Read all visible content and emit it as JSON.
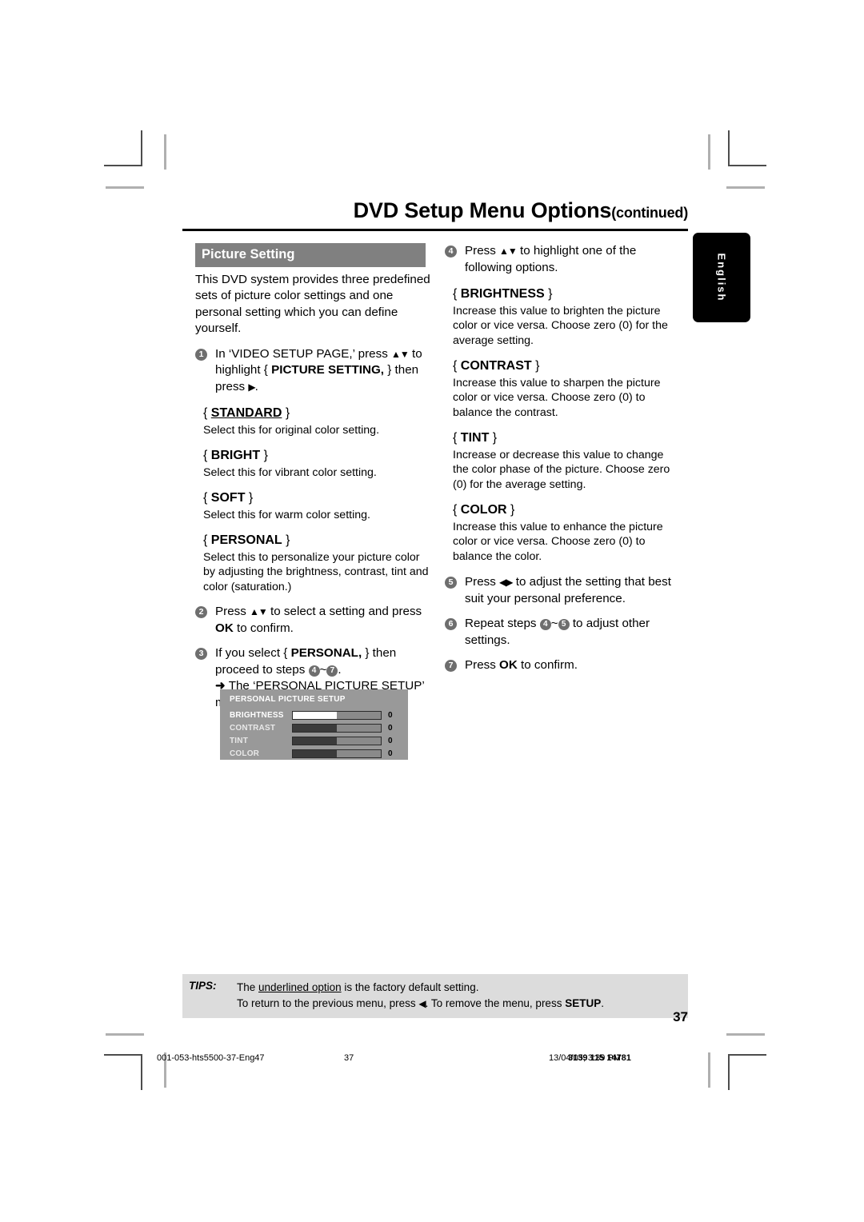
{
  "header": {
    "title": "DVD Setup Menu Options",
    "continued": "(continued)"
  },
  "language_tab": {
    "label": "English"
  },
  "left_column": {
    "section_title": "Picture Setting",
    "intro": "This DVD system provides three predefined sets of picture color settings and one personal setting which you can define yourself.",
    "step1": {
      "number": "1",
      "text_a": "In ‘VIDEO SETUP PAGE,’ press ",
      "arrows": "▲▼",
      "text_b": " to highlight { ",
      "bold_term": "PICTURE SETTING,",
      "text_c": " } then press ",
      "arrow_right": "▶",
      "text_d": "."
    },
    "options": [
      {
        "name": "STANDARD",
        "underlined": true,
        "desc": "Select this for original color setting."
      },
      {
        "name": "BRIGHT",
        "underlined": false,
        "desc": "Select this for vibrant color setting."
      },
      {
        "name": "SOFT",
        "underlined": false,
        "desc": "Select this for warm color setting."
      },
      {
        "name": "PERSONAL",
        "underlined": false,
        "desc": "Select this to personalize your picture color by adjusting the brightness, contrast, tint and color (saturation.)"
      }
    ],
    "step2": {
      "number": "2",
      "text_a": "Press ",
      "arrows": "▲▼",
      "text_b": " to select a setting and press ",
      "bold_term": "OK",
      "text_c": " to confirm."
    },
    "step3": {
      "number": "3",
      "text_a": "If you select { ",
      "bold_term": "PERSONAL,",
      "text_b": " } then proceed to steps ",
      "range_from": "4",
      "range_sep": "~",
      "range_to": "7",
      "text_c": ".",
      "arrow_note": "The ‘PERSONAL PICTURE SETUP’ menu appears.",
      "arrow_glyph": "➜"
    }
  },
  "osd_menu": {
    "title": "PERSONAL PICTURE SETUP",
    "rows": [
      {
        "label": "BRIGHTNESS",
        "value": "0",
        "fill_percent": 50,
        "selected": true
      },
      {
        "label": "CONTRAST",
        "value": "0",
        "fill_percent": 50,
        "selected": false
      },
      {
        "label": "TINT",
        "value": "0",
        "fill_percent": 50,
        "selected": false
      },
      {
        "label": "COLOR",
        "value": "0",
        "fill_percent": 50,
        "selected": false
      }
    ]
  },
  "right_column": {
    "step4": {
      "number": "4",
      "text_a": "Press ",
      "arrows": "▲▼",
      "text_b": " to highlight one of the following options."
    },
    "options": [
      {
        "name": "BRIGHTNESS",
        "desc": "Increase this value to brighten the picture color or vice versa. Choose zero (0) for the average setting."
      },
      {
        "name": "CONTRAST",
        "desc": "Increase this value to sharpen the picture color or vice versa.  Choose zero (0) to balance the contrast."
      },
      {
        "name": "TINT",
        "desc": "Increase or decrease this value to change the color phase of the picture.  Choose zero (0) for the average setting."
      },
      {
        "name": "COLOR",
        "desc": "Increase this value to enhance the picture color or vice versa. Choose zero (0) to balance the color."
      }
    ],
    "step5": {
      "number": "5",
      "text_a": "Press ",
      "arrows": "◀▶",
      "text_b": "  to adjust the setting that best suit your personal preference."
    },
    "step6": {
      "number": "6",
      "text_a": "Repeat steps ",
      "range_from": "4",
      "range_sep": "~",
      "range_to": "5",
      "text_b": " to adjust other settings."
    },
    "step7": {
      "number": "7",
      "text_a": "Press ",
      "bold_term": "OK",
      "text_b": " to confirm."
    }
  },
  "tips": {
    "label": "TIPS:",
    "line1_a": "The ",
    "line1_u": "underlined option",
    "line1_b": " is the factory default setting.",
    "line2_a": "To return to the previous menu, press ",
    "line2_arrow": "◀",
    "line2_b": ". To remove the menu, press ",
    "line2_bold": "SETUP",
    "line2_c": "."
  },
  "page_number": "37",
  "footer_meta": {
    "file": "001-053-hts5500-37-Eng47",
    "page": "37",
    "date": "13/04/05, 3:39 PM",
    "code": "3139 115 14781"
  },
  "colors": {
    "section_bar": "#808080",
    "bullet": "#6e6e6e",
    "tips_bg": "#dcdcdc",
    "osd_bg": "#999999",
    "lang_tab": "#000000"
  }
}
